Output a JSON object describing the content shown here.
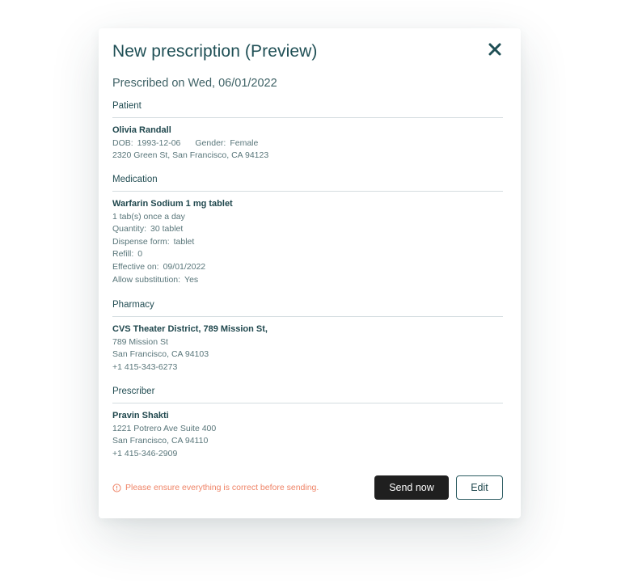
{
  "colors": {
    "title": "#1f4f55",
    "text_muted": "#59767a",
    "warning": "#ef8366",
    "primary_button": "#1f1f1f",
    "divider": "#d5dde0"
  },
  "modal": {
    "title": "New prescription (Preview)",
    "close_icon": "close-icon",
    "prescribed_on": "Prescribed on Wed, 06/01/2022"
  },
  "patient": {
    "label": "Patient",
    "name": "Olivia Randall",
    "dob_label": "DOB:",
    "dob": "1993-12-06",
    "gender_label": "Gender:",
    "gender": "Female",
    "address": "2320 Green St, San Francisco, CA 94123"
  },
  "medication": {
    "label": "Medication",
    "name": "Warfarin Sodium  1 mg tablet",
    "sig": "1 tab(s) once a day",
    "quantity_label": "Quantity:",
    "quantity": "30 tablet",
    "dispense_label": "Dispense form:",
    "dispense": "tablet",
    "refill_label": "Refill:",
    "refill": "0",
    "effective_label": "Effective on:",
    "effective": "09/01/2022",
    "substitution_label": "Allow substitution:",
    "substitution": "Yes"
  },
  "pharmacy": {
    "label": "Pharmacy",
    "name": "CVS Theater District, 789 Mission St,",
    "street": "789 Mission St",
    "city": "San Francisco, CA 94103",
    "phone": "+1 415-343-6273"
  },
  "prescriber": {
    "label": "Prescriber",
    "name": "Pravin Shakti",
    "street": "1221 Potrero Ave Suite 400",
    "city": "San Francisco, CA 94110",
    "phone": "+1 415-346-2909"
  },
  "footer": {
    "warning_icon": "info-circle-icon",
    "warning": "Please ensure everything is correct before sending.",
    "send_label": "Send now",
    "edit_label": "Edit"
  }
}
